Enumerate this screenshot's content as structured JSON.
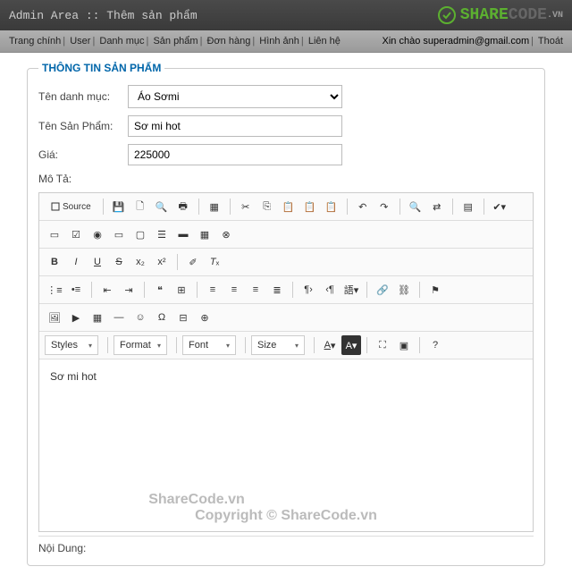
{
  "header": {
    "title": "Admin Area :: Thêm sản phẩm",
    "logo_share": "SHARE",
    "logo_code": "CODE",
    "logo_vn": ".VN"
  },
  "nav": {
    "left": [
      "Trang chính",
      "User",
      "Danh mục",
      "Sản phẩm",
      "Đơn hàng",
      "Hình ảnh",
      "Liên hệ"
    ],
    "greeting": "Xin chào superadmin@gmail.com",
    "logout": "Thoát"
  },
  "legend": "THÔNG TIN SẢN PHẨM",
  "labels": {
    "category": "Tên danh mục:",
    "name": "Tên Sản Phẩm:",
    "price": "Giá:",
    "desc": "Mô Tả:",
    "content": "Nội Dung:"
  },
  "values": {
    "category": "Áo Sơmi",
    "name": "Sơ mi hot",
    "price": "225000",
    "editor_text": "Sơ mi hot"
  },
  "editor": {
    "source": "Source",
    "dropdowns": {
      "styles": "Styles",
      "format": "Format",
      "font": "Font",
      "size": "Size"
    }
  },
  "watermark": {
    "w1": "ShareCode.vn",
    "w2": "Copyright © ShareCode.vn"
  }
}
